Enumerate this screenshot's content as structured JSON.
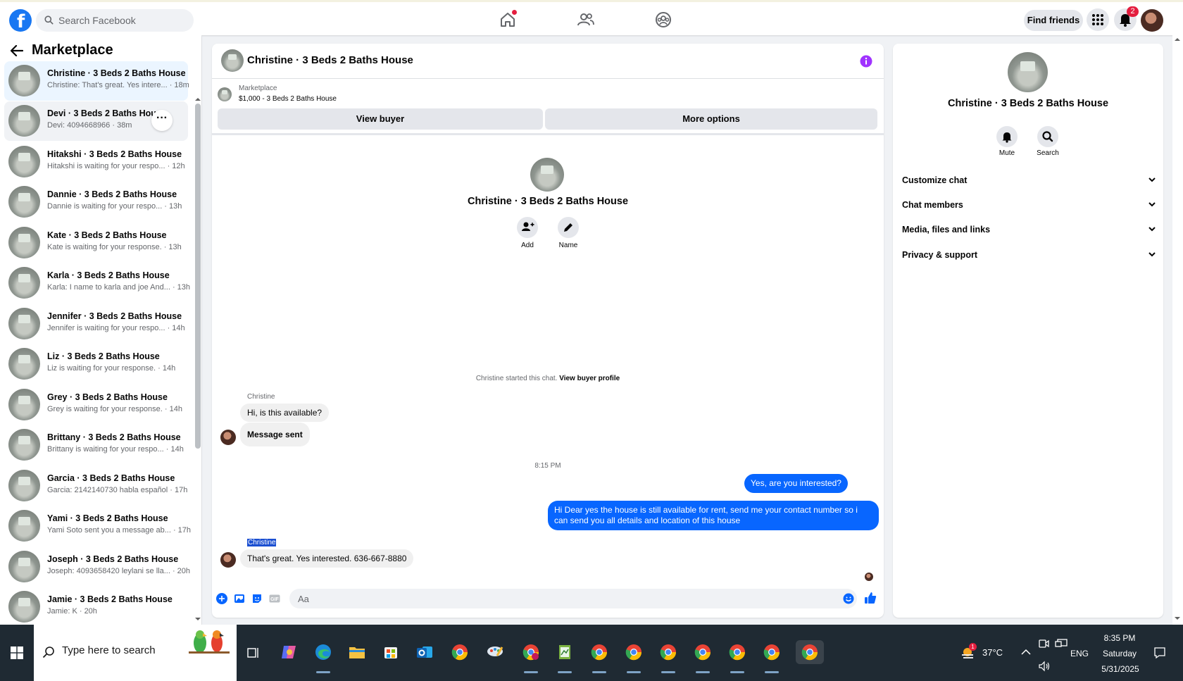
{
  "topbar": {
    "logo": "f",
    "search_placeholder": "Search Facebook",
    "find_friends": "Find friends",
    "notification_count": "2",
    "accent": "#1877f2"
  },
  "left": {
    "title": "Marketplace",
    "chats": [
      {
        "name": "Christine · 3 Beds 2 Baths House",
        "snippet": "Christine: That's great. Yes intere... · 18m"
      },
      {
        "name": "Devi · 3 Beds 2 Baths House",
        "snippet": "Devi: 4094668966 · 38m"
      },
      {
        "name": "Hitakshi · 3 Beds 2 Baths House",
        "snippet": "Hitakshi is waiting for your respo... · 12h"
      },
      {
        "name": "Dannie · 3 Beds 2 Baths House",
        "snippet": "Dannie is waiting for your respo... · 13h"
      },
      {
        "name": "Kate · 3 Beds 2 Baths House",
        "snippet": "Kate is waiting for your response. · 13h"
      },
      {
        "name": "Karla · 3 Beds 2 Baths House",
        "snippet": "Karla: I name to karla and joe And... · 13h"
      },
      {
        "name": "Jennifer · 3 Beds 2 Baths House",
        "snippet": "Jennifer is waiting for your respo... · 14h"
      },
      {
        "name": "Liz · 3 Beds 2 Baths House",
        "snippet": "Liz is waiting for your response. · 14h"
      },
      {
        "name": "Grey · 3 Beds 2 Baths House",
        "snippet": "Grey is waiting for your response. · 14h"
      },
      {
        "name": "Brittany · 3 Beds 2 Baths House",
        "snippet": "Brittany is waiting for your respo... · 14h"
      },
      {
        "name": "Garcia · 3 Beds 2 Baths House",
        "snippet": "Garcia: 2142140730 habla español · 17h"
      },
      {
        "name": "Yami · 3 Beds 2 Baths House",
        "snippet": "Yami Soto sent you a message ab... · 17h"
      },
      {
        "name": "Joseph · 3 Beds 2 Baths House",
        "snippet": "Joseph: 4093658420 leylani se lla... · 20h"
      },
      {
        "name": "Jamie · 3 Beds 2 Baths House",
        "snippet": "Jamie: K · 20h"
      }
    ]
  },
  "conversation": {
    "title": "Christine · 3 Beds 2 Baths House",
    "marketplace_label": "Marketplace",
    "listing": "$1,000 - 3 Beds 2 Baths House",
    "view_buyer": "View buyer",
    "more_options": "More options",
    "center_name": "Christine · 3 Beds 2 Baths House",
    "add_label": "Add",
    "name_label": "Name",
    "system_text": "Christine started this chat.",
    "system_link": "View buyer profile",
    "sender": "Christine",
    "msg1": "Hi, is this available?",
    "msg2": "Message sent",
    "time": "8:15 PM",
    "out1": "Yes, are you interested?",
    "out2": "Hi Dear yes the house is still available for rent, send me your contact number so i can send you all details and location of this house",
    "sender2": "Christine",
    "msg3": "That's great. Yes interested. 636-667-8880",
    "composer_placeholder": "Aa",
    "bubble_color": "#0866ff"
  },
  "right": {
    "name": "Christine · 3 Beds 2 Baths House",
    "mute": "Mute",
    "search": "Search",
    "rows": [
      "Customize chat",
      "Chat members",
      "Media, files and links",
      "Privacy & support"
    ]
  },
  "taskbar": {
    "search_placeholder": "Type here to search",
    "weather": "37°C",
    "lang": "ENG",
    "time": "8:35 PM",
    "day": "Saturday",
    "date": "5/31/2025",
    "weather_badge": "1"
  }
}
